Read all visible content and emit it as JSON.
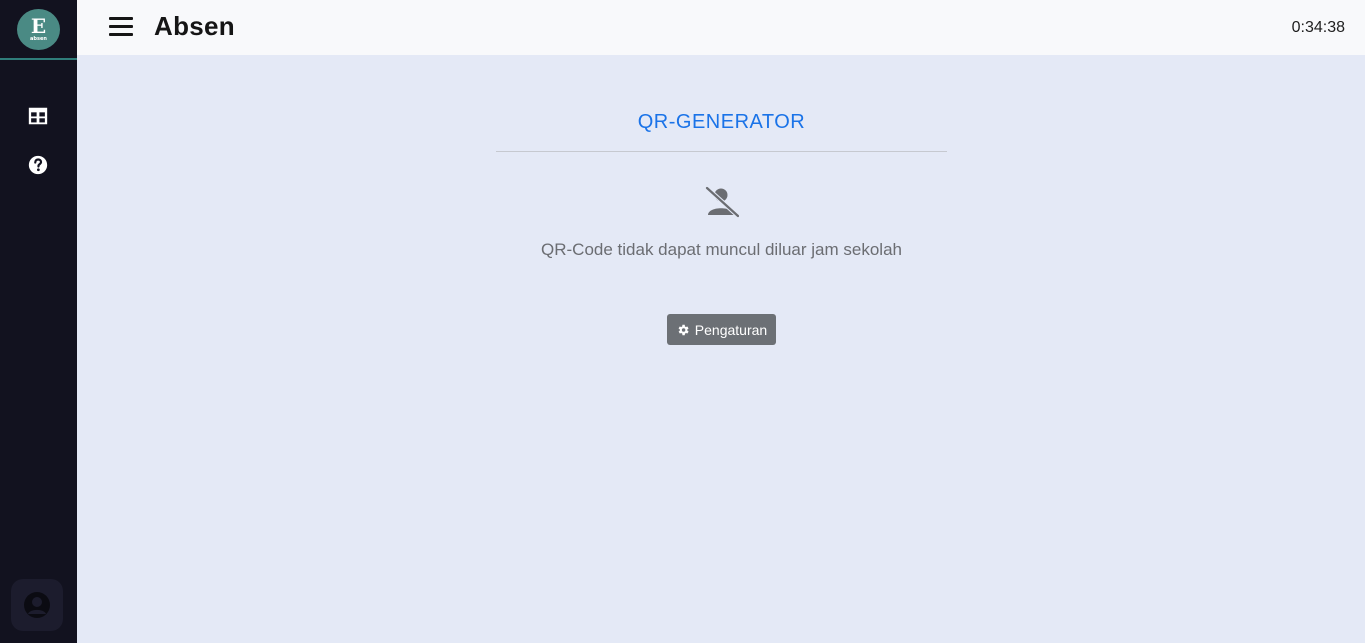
{
  "app": {
    "title": "Absen",
    "logo_text": "absen",
    "clock": "0:34:38"
  },
  "sidebar": {
    "items": [
      {
        "icon": "table-icon"
      },
      {
        "icon": "help-icon"
      }
    ],
    "profile_icon": "user-icon"
  },
  "main": {
    "heading": "QR-GENERATOR",
    "empty_icon": "user-slash-icon",
    "message": "QR-Code tidak dapat muncul diluar jam sekolah",
    "settings_button": "Pengaturan",
    "settings_icon": "gear-icon"
  },
  "colors": {
    "sidebar_bg": "#12121f",
    "accent": "#1a73e8",
    "content_bg": "#e4e9f6",
    "button_bg": "#6c7075"
  }
}
